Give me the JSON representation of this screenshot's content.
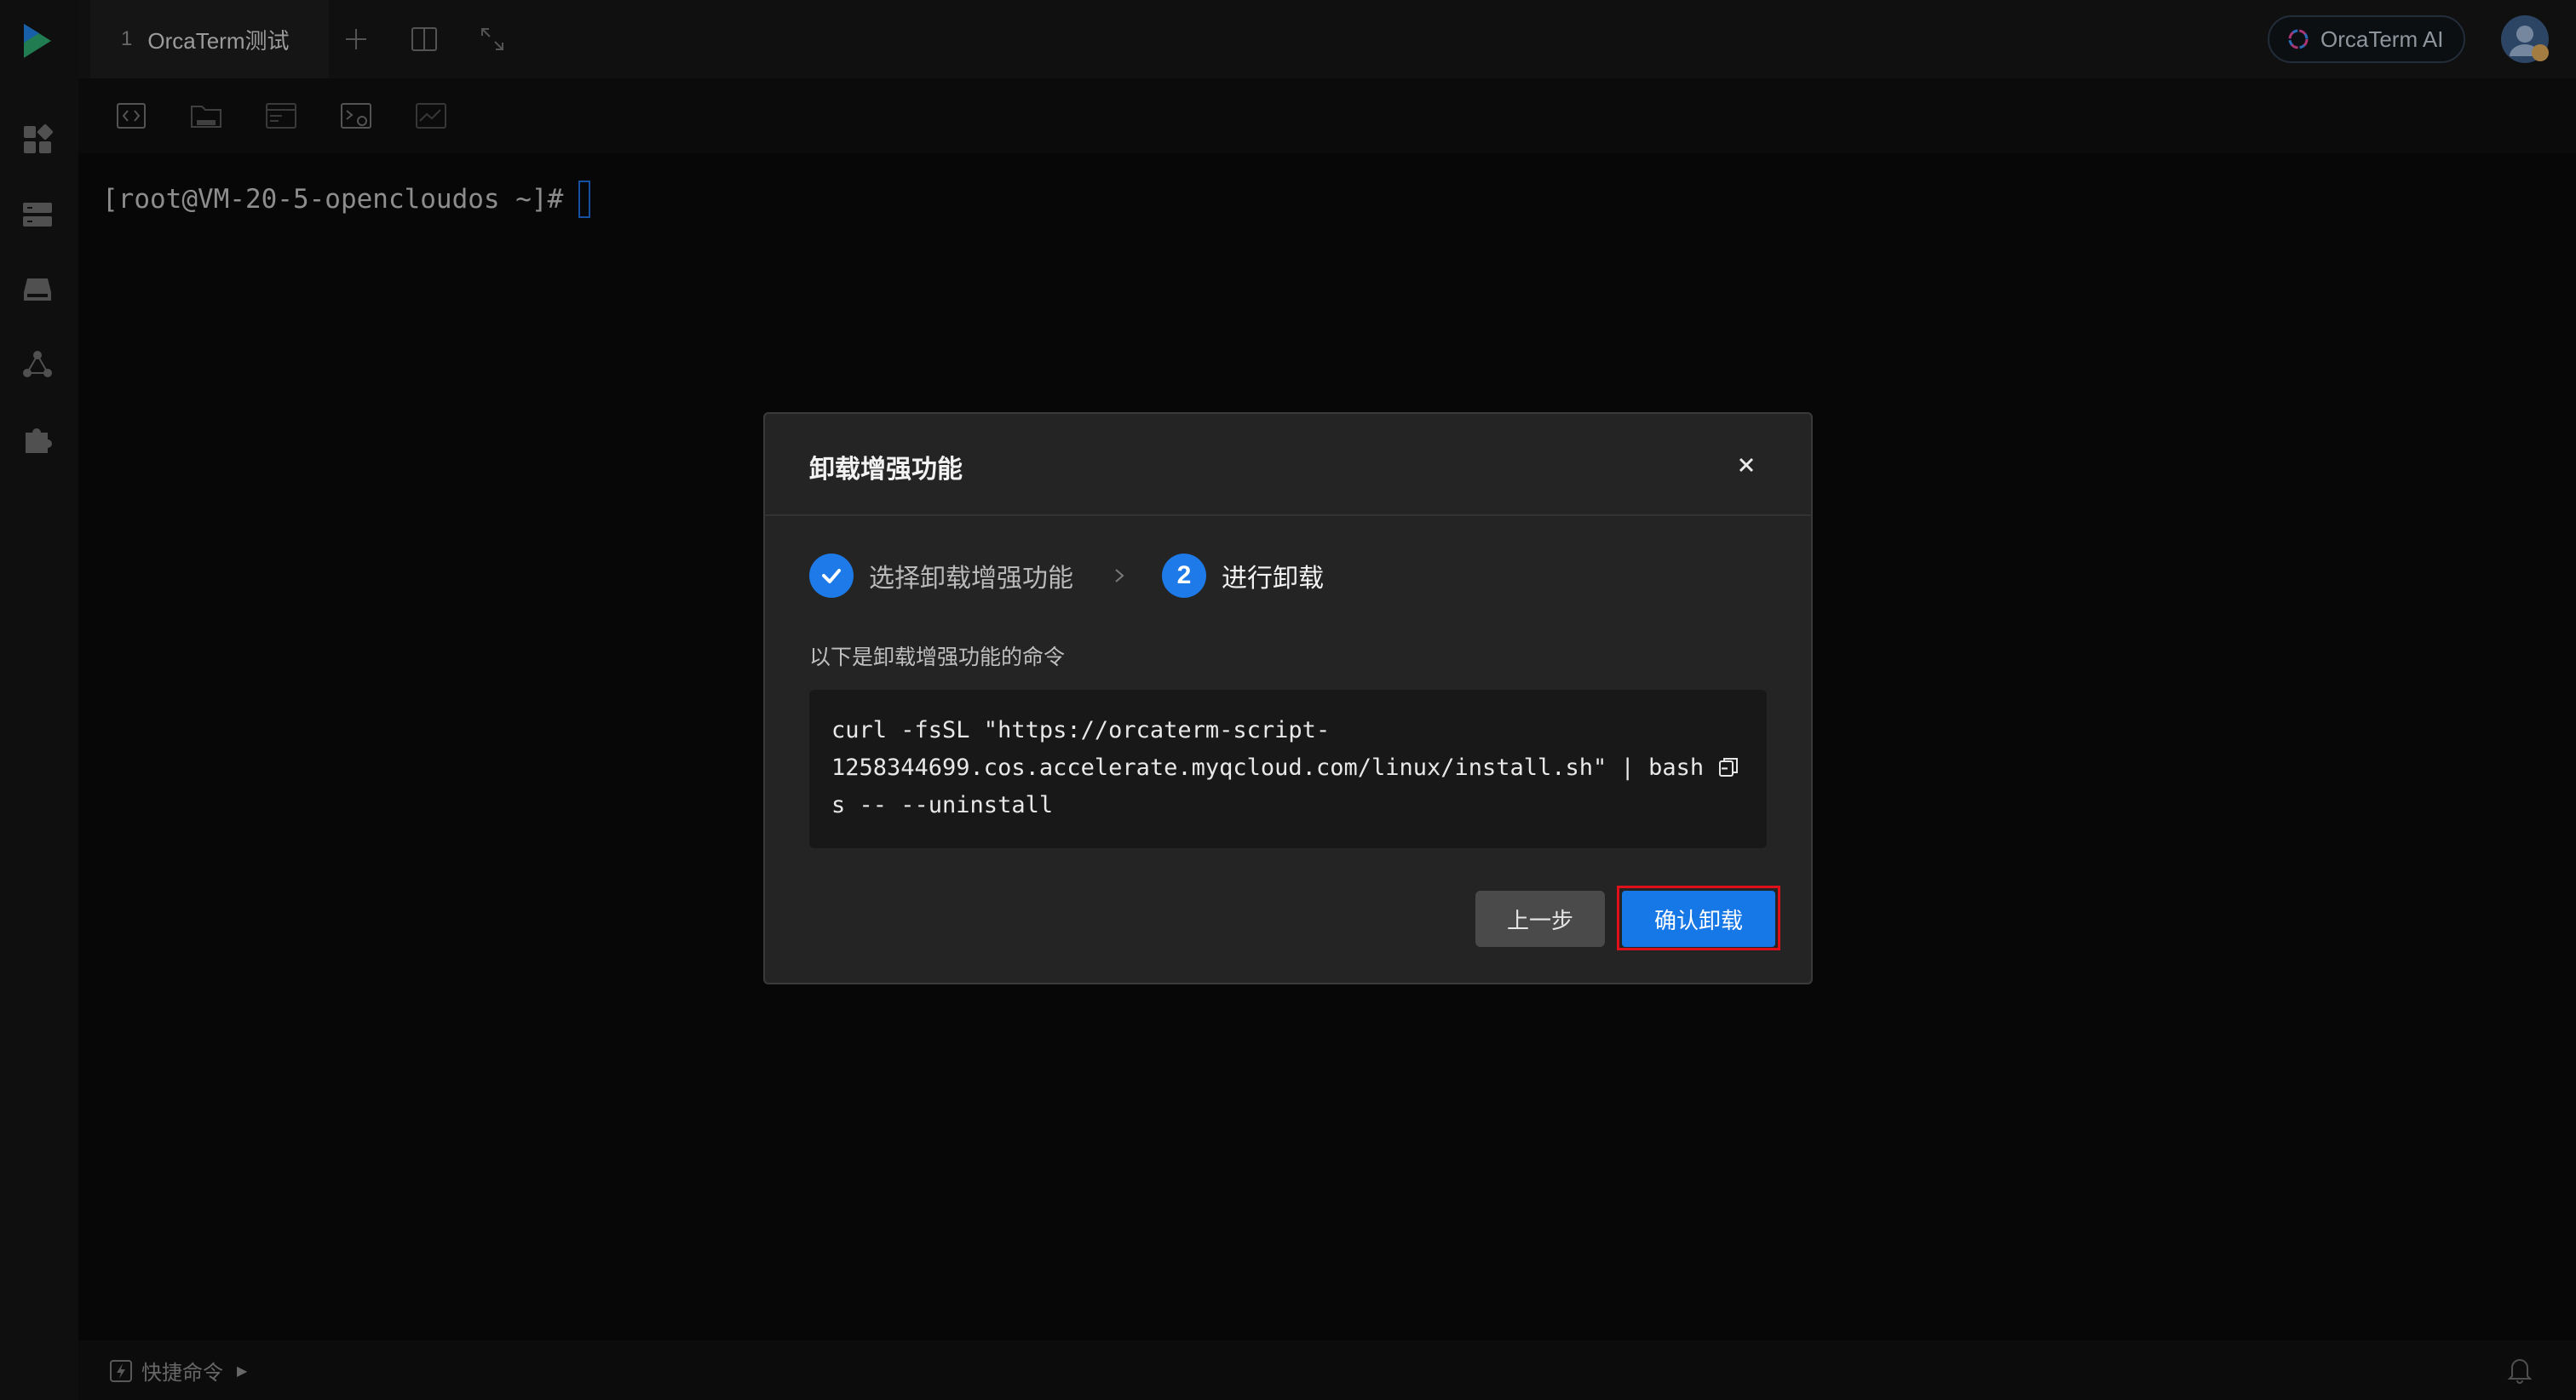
{
  "tab": {
    "index": "1",
    "title": "OrcaTerm测试"
  },
  "ai_button": {
    "label": "OrcaTerm AI"
  },
  "terminal": {
    "prompt": "[root@VM-20-5-opencloudos ~]#"
  },
  "bottombar": {
    "quick_commands_label": "快捷命令"
  },
  "modal": {
    "title": "卸载增强功能",
    "steps": [
      {
        "number": "",
        "label": "选择卸载增强功能",
        "status": "done"
      },
      {
        "number": "2",
        "label": "进行卸载",
        "status": "active"
      }
    ],
    "command_description": "以下是卸载增强功能的命令",
    "command_lines": [
      "curl -fsSL \"https://orcaterm-script-",
      "1258344699.cos.accelerate.myqcloud.com/linux/install.sh\" | bash -",
      "s -- --uninstall"
    ],
    "prev_label": "上一步",
    "confirm_label": "确认卸载"
  },
  "colors": {
    "accent": "#1677e6",
    "highlight_ring": "#e0101a",
    "background": "#0b0b0b"
  },
  "icons": {
    "sidebar": [
      "dashboard-icon",
      "server-icon",
      "drive-icon",
      "network-icon",
      "plugin-icon"
    ],
    "toolbar": [
      "code-icon",
      "sftp-folder-icon",
      "window-icon",
      "terminal-settings-icon",
      "monitor-icon"
    ]
  }
}
